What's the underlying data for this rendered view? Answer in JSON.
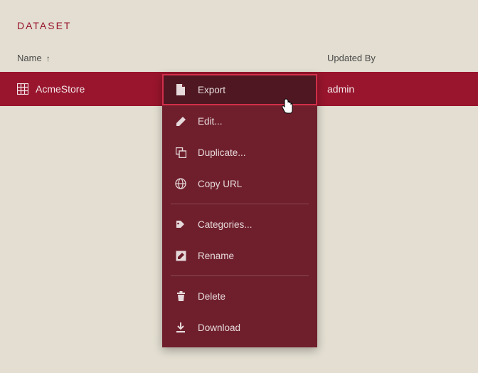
{
  "header": {
    "label": "DATASET"
  },
  "columns": {
    "name": "Name",
    "sort_indicator": "↑",
    "updated_by": "Updated By"
  },
  "row": {
    "name": "AcmeStore",
    "updated_by": "admin"
  },
  "menu": {
    "export": "Export",
    "edit": "Edit...",
    "duplicate": "Duplicate...",
    "copy_url": "Copy URL",
    "categories": "Categories...",
    "rename": "Rename",
    "delete": "Delete",
    "download": "Download"
  }
}
